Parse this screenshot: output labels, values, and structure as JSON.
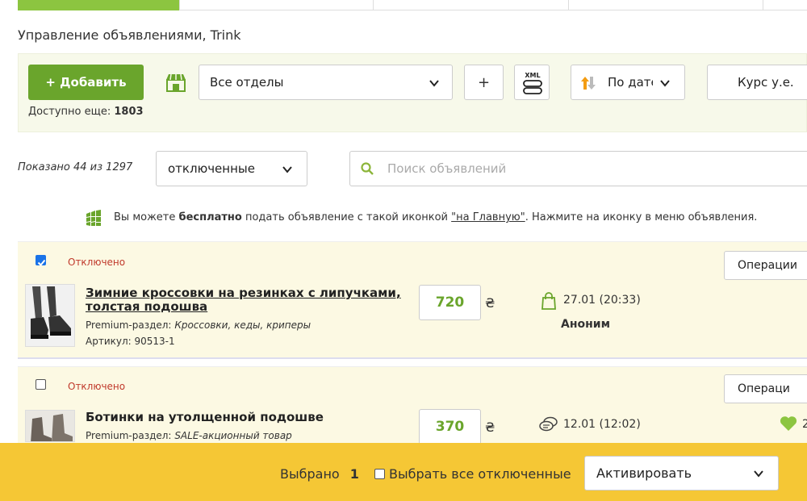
{
  "header": {
    "title": "Управление объявлениями, Trink"
  },
  "toolbar": {
    "add_label": "+ Добавить",
    "available_label": "Доступно еще:",
    "available_count": "1803",
    "department_value": "Все отделы",
    "plus_label": "+",
    "xml_label": "XML",
    "sort_label": "По дате",
    "rate_label": "Курс у.е."
  },
  "filter": {
    "shown_text": "Показано 44 из 1297",
    "status_value": "отключенные",
    "search_placeholder": "Поиск объявлений"
  },
  "promo": {
    "text_before": "Вы можете",
    "bold": "бесплатно",
    "text_middle": "подать объявление с такой иконкой",
    "link": "\"на Главную\"",
    "text_after": ". Нажмите на иконку в меню объявления."
  },
  "listings": [
    {
      "checked": true,
      "status": "Отключено",
      "operations_label": "Операции",
      "title": "Зимние кроссовки на резинках с липучками, толстая подошва",
      "section_label": "Premium-раздел:",
      "section_value": "Кроссовки, кеды, криперы",
      "article": "Артикул: 90513-1",
      "price": "720",
      "currency": "₴",
      "date": "27.01 (20:33)",
      "author": "Аноним"
    },
    {
      "checked": false,
      "status": "Отключено",
      "operations_label": "Операци",
      "title": "Ботинки на утолщенной подошве",
      "section_label": "Premium-раздел:",
      "section_value": "SALE-акционный товар",
      "price": "370",
      "currency": "₴",
      "date": "12.01 (12:02)",
      "likes": "2"
    }
  ],
  "bottom_bar": {
    "selected_label": "Выбрано",
    "selected_count": "1",
    "select_all_label": "Выбрать все отключенные",
    "action_value": "Активировать"
  },
  "colors": {
    "accent_green": "#6aa52c",
    "bottom_bar": "#f5c735",
    "card_bg": "#fcf9e3",
    "status_red": "#c0392b"
  }
}
